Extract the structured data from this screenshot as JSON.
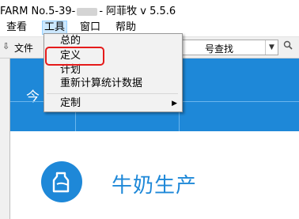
{
  "window": {
    "title_prefix": "FARM No.5-39-",
    "title_suffix": "- 阿菲牧 v 5.5.6"
  },
  "menubar": {
    "items": [
      "查看",
      "工具",
      "窗口",
      "帮助"
    ]
  },
  "toolbar": {
    "file_label": "文件",
    "search_value": "号查找"
  },
  "dropdown": {
    "items": [
      {
        "label": "总的",
        "submenu": false
      },
      {
        "label": "定义",
        "submenu": false
      },
      {
        "label": "计划",
        "submenu": false
      },
      {
        "label": "重新计算统计数据",
        "submenu": false
      },
      {
        "label": "定制",
        "submenu": true
      }
    ]
  },
  "banner": {
    "partial_text": "今"
  },
  "card": {
    "title": "牛奶生产"
  },
  "colors": {
    "accent": "#1e88d8",
    "highlight": "#e51b1b",
    "menu_active": "#cce8ff"
  },
  "icons": {
    "toolbar": "tool-icon",
    "dropdown": "dropdown-arrow-icon",
    "search": "search-icon",
    "submenu": "chevron-right-icon",
    "card": "milk-bottle-icon"
  }
}
